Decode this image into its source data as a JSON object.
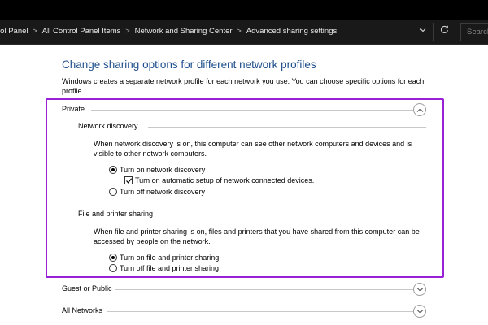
{
  "address_bar": {
    "breadcrumbs": [
      "rol Panel",
      "All Control Panel Items",
      "Network and Sharing Center",
      "Advanced sharing settings"
    ],
    "separator": ">",
    "dropdown_icon": "chevron-down-icon",
    "refresh_icon": "refresh-icon",
    "search_placeholder": "Search"
  },
  "page": {
    "heading": "Change sharing options for different network profiles",
    "intro": "Windows creates a separate network profile for each network you use. You can choose specific options for each profile."
  },
  "profiles": {
    "private": {
      "title": "Private",
      "expanded": true,
      "network_discovery": {
        "title": "Network discovery",
        "description": "When network discovery is on, this computer can see other network computers and devices and is visible to other network computers.",
        "options": {
          "on": {
            "label": "Turn on network discovery",
            "selected": true
          },
          "auto_setup": {
            "label": "Turn on automatic setup of network connected devices.",
            "checked": true
          },
          "off": {
            "label": "Turn off network discovery",
            "selected": false
          }
        }
      },
      "file_printer_sharing": {
        "title": "File and printer sharing",
        "description": "When file and printer sharing is on, files and printers that you have shared from this computer can be accessed by people on the network.",
        "options": {
          "on": {
            "label": "Turn on file and printer sharing",
            "selected": true
          },
          "off": {
            "label": "Turn off file and printer sharing",
            "selected": false
          }
        }
      }
    },
    "guest_public": {
      "title": "Guest or Public",
      "expanded": false
    },
    "all_networks": {
      "title": "All Networks",
      "expanded": false
    }
  },
  "colors": {
    "heading_blue": "#1e4e8c",
    "highlight_purple": "#9b1fd6",
    "address_bar_bg": "#191919"
  }
}
